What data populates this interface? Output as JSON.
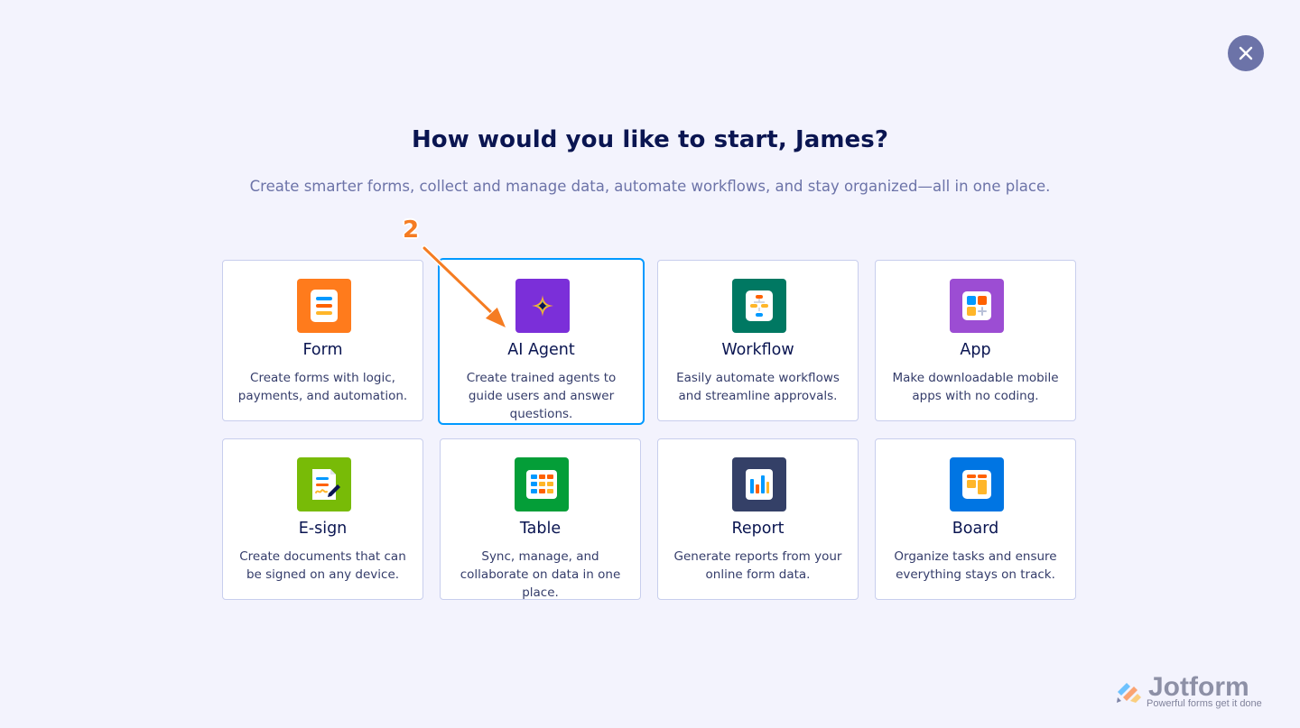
{
  "modal": {
    "title": "How would you like to start, James?",
    "subtitle": "Create smarter forms, collect and manage data, automate workflows, and stay organized—all in one place."
  },
  "options": [
    {
      "title": "Form",
      "description": "Create forms with logic, payments, and automation.",
      "icon": "form-icon",
      "color": "#ff7b1c"
    },
    {
      "title": "AI Agent",
      "description": "Create trained agents to guide users and answer questions.",
      "icon": "ai-agent-icon",
      "color": "#7b2fd9",
      "selected": true
    },
    {
      "title": "Workflow",
      "description": "Easily automate workflows and streamline approvals.",
      "icon": "workflow-icon",
      "color": "#007862"
    },
    {
      "title": "App",
      "description": "Make downloadable mobile apps with no coding.",
      "icon": "app-icon",
      "color": "#9c4dd3"
    },
    {
      "title": "E-sign",
      "description": "Create documents that can be signed on any device.",
      "icon": "esign-icon",
      "color": "#78bb07"
    },
    {
      "title": "Table",
      "description": "Sync, manage, and collaborate on data in one place.",
      "icon": "table-icon",
      "color": "#049e38"
    },
    {
      "title": "Report",
      "description": "Generate reports from your online form data.",
      "icon": "report-icon",
      "color": "#344067"
    },
    {
      "title": "Board",
      "description": "Organize tasks and ensure everything stays on track.",
      "icon": "board-icon",
      "color": "#0075e3"
    }
  ],
  "annotation": {
    "step_number": "2"
  },
  "brand": {
    "name": "Jotform",
    "tagline": "Powerful forms get it done"
  },
  "colors": {
    "background": "#f3f3fd",
    "close_button": "#6c73a8",
    "selected_border": "#0099ff",
    "annotation": "#f57c22"
  }
}
